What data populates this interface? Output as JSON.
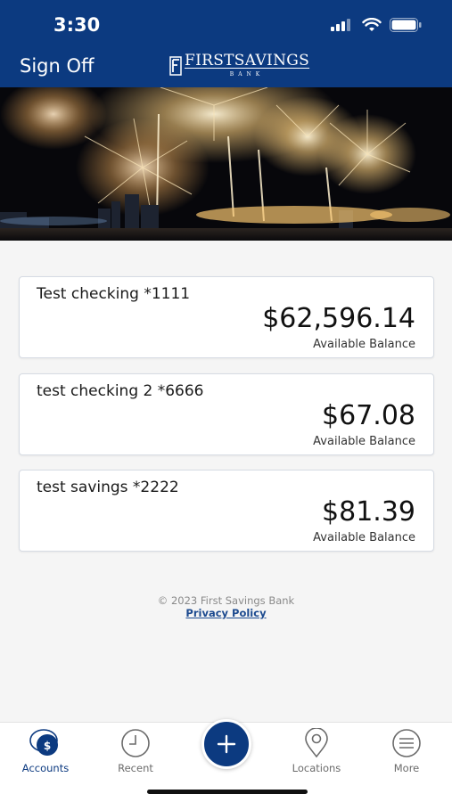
{
  "status_bar": {
    "time": "3:30"
  },
  "header": {
    "sign_off_label": "Sign Off",
    "logo_text": "FIRSTSAVINGS",
    "logo_subtext": "BANK"
  },
  "accounts": [
    {
      "name": "Test checking *1111",
      "balance": "$62,596.14",
      "balance_label": "Available Balance"
    },
    {
      "name": "test checking 2 *6666",
      "balance": "$67.08",
      "balance_label": "Available Balance"
    },
    {
      "name": "test savings *2222",
      "balance": "$81.39",
      "balance_label": "Available Balance"
    }
  ],
  "footer": {
    "copyright": "© 2023 First Savings Bank",
    "privacy_link": "Privacy Policy"
  },
  "tabbar": {
    "tabs": [
      {
        "label": "Accounts",
        "icon": "accounts-icon",
        "active": true
      },
      {
        "label": "Recent",
        "icon": "clock-icon",
        "active": false
      },
      {
        "label": "",
        "icon": "plus-icon",
        "active": false
      },
      {
        "label": "Locations",
        "icon": "location-pin-icon",
        "active": false
      },
      {
        "label": "More",
        "icon": "menu-icon",
        "active": false
      }
    ]
  },
  "colors": {
    "brand_navy": "#0c3a80",
    "link_blue": "#1c4a8f",
    "background": "#f5f5f5"
  }
}
